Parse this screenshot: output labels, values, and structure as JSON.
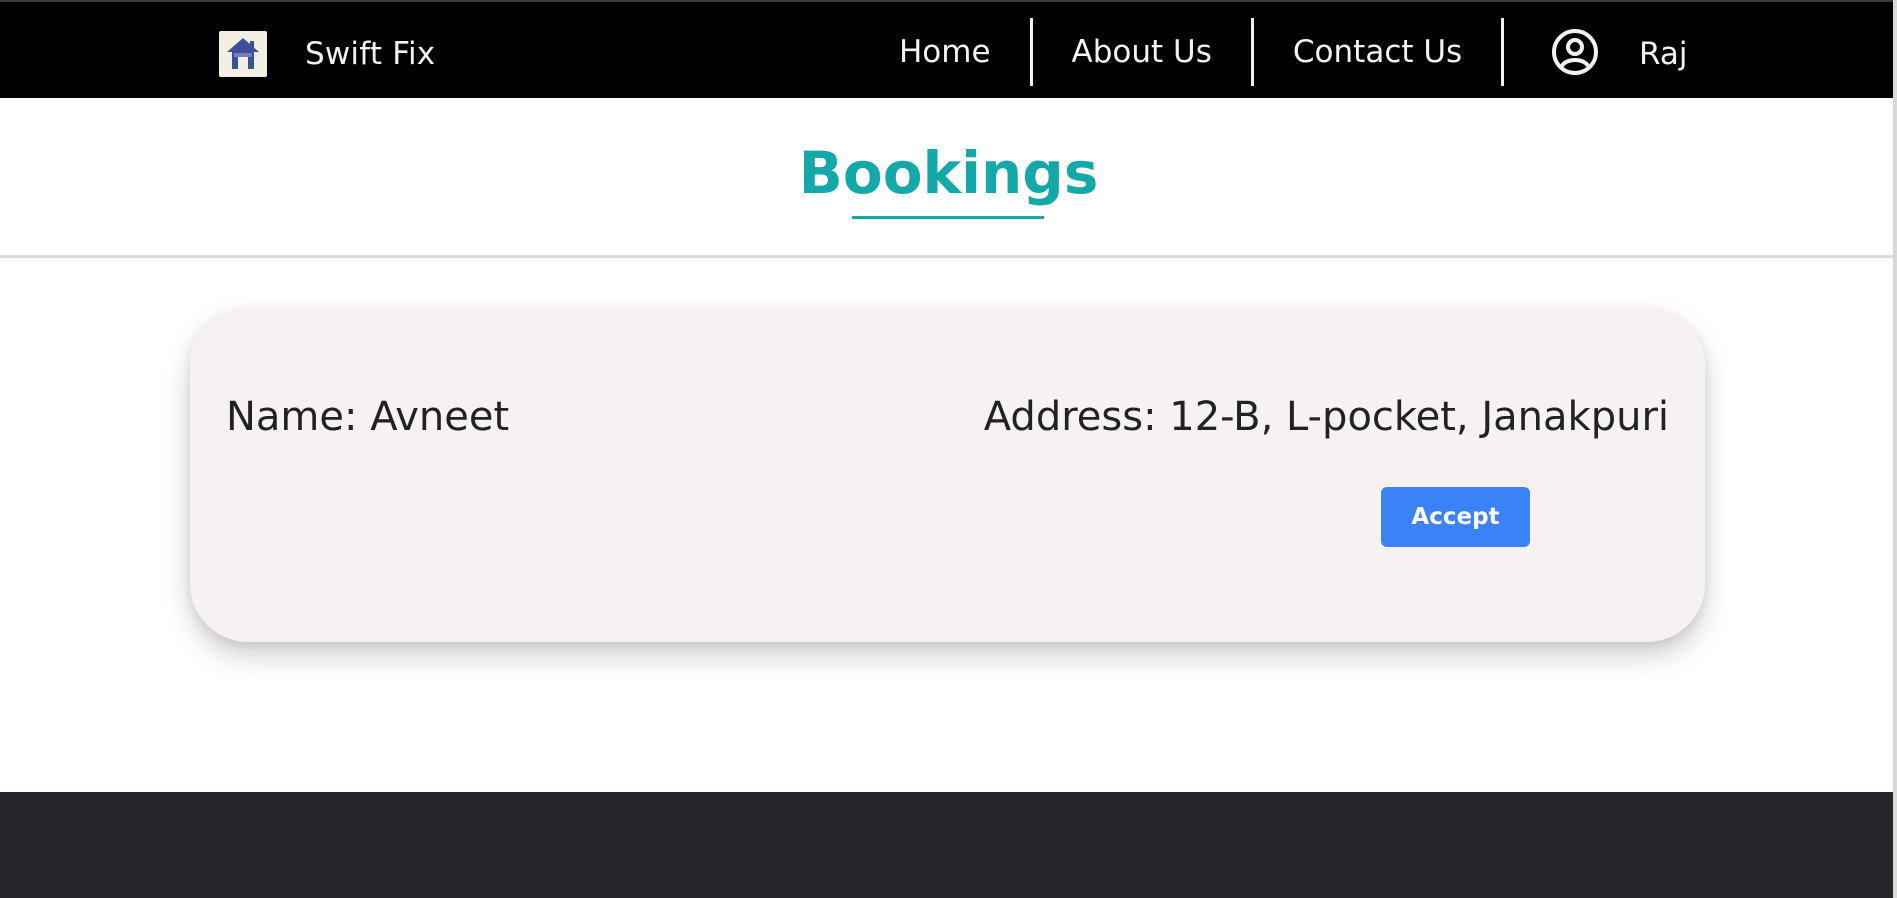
{
  "navbar": {
    "brand_name": "Swift Fix",
    "links": [
      {
        "label": "Home"
      },
      {
        "label": "About Us"
      },
      {
        "label": "Contact Us"
      }
    ],
    "user_name": "Raj"
  },
  "page": {
    "title": "Bookings"
  },
  "booking": {
    "name_label": "Name: Avneet",
    "address_label": "Address: 12-B, L-pocket, Janakpuri",
    "accept_label": "Accept"
  },
  "colors": {
    "navbar_bg": "#000000",
    "accent_teal": "#14a8a8",
    "button_blue": "#3b82f6",
    "card_bg": "#f5f2f1",
    "footer_bg": "#25262b"
  },
  "icons": {
    "logo": "house-logo-icon",
    "user": "user-circle-icon"
  }
}
